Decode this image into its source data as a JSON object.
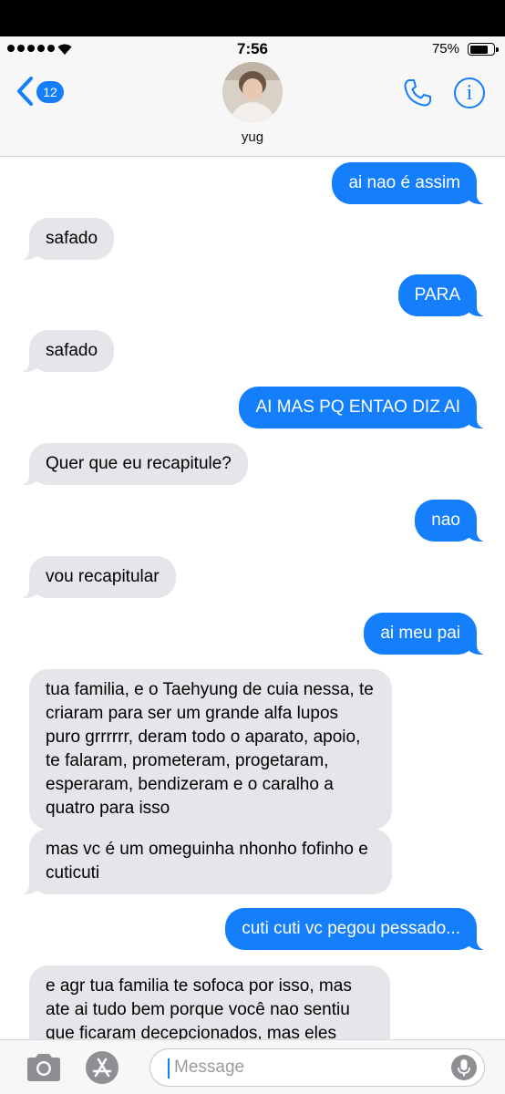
{
  "status": {
    "time": "7:56",
    "battery": "75%",
    "signal_icon": "signal-dots-icon",
    "wifi_icon": "wifi-icon"
  },
  "nav": {
    "back_badge": "12",
    "contact_name": "yug",
    "phone_icon": "phone-icon",
    "info_icon": "info-icon",
    "info_glyph": "i"
  },
  "messages": [
    {
      "dir": "out",
      "text": "ai nao é assim"
    },
    {
      "dir": "in",
      "text": "safado"
    },
    {
      "dir": "out",
      "text": "PARA"
    },
    {
      "dir": "in",
      "text": "safado"
    },
    {
      "dir": "out",
      "text": "AI MAS PQ ENTAO DIZ AI"
    },
    {
      "dir": "in",
      "text": "Quer que eu recapitule?"
    },
    {
      "dir": "out",
      "text": "nao"
    },
    {
      "dir": "in",
      "text": "vou recapitular"
    },
    {
      "dir": "out",
      "text": "ai meu pai"
    },
    {
      "dir": "in",
      "text": "tua familia, e o Taehyung de cuia nessa, te criaram para ser um grande alfa lupos puro grrrrrr, deram todo o aparato, apoio, te falaram, prometeram, progetaram, esperaram, bendizeram e o caralho a quatro para isso"
    },
    {
      "dir": "in",
      "text": "mas vc é um omeguinha nhonho fofinho e cuticuti"
    },
    {
      "dir": "out",
      "text": "cuti cuti vc pegou pessado..."
    },
    {
      "dir": "in",
      "text": "e agr tua familia te sofoca por isso, mas ate ai tudo bem porque você nao sentiu que ficaram decepcionados, mas eles"
    }
  ],
  "input": {
    "placeholder": "Message",
    "camera_icon": "camera-icon",
    "appstore_icon": "app-store-icon",
    "mic_icon": "microphone-icon"
  },
  "colors": {
    "accent": "#147efb",
    "incoming_bubble": "#e5e5ea",
    "bar_bg": "#f7f7f7"
  }
}
